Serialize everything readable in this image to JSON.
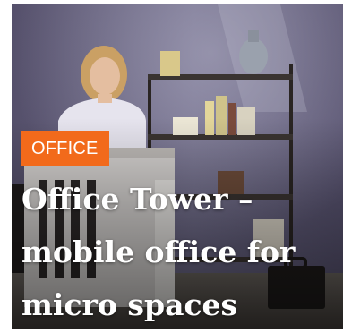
{
  "article": {
    "category": "OFFICE",
    "title": "Office Tower – mobile office for micro spaces"
  },
  "colors": {
    "badge_background": "#f26a1b",
    "title_text": "#ffffff",
    "wall": "#5e5a73"
  }
}
